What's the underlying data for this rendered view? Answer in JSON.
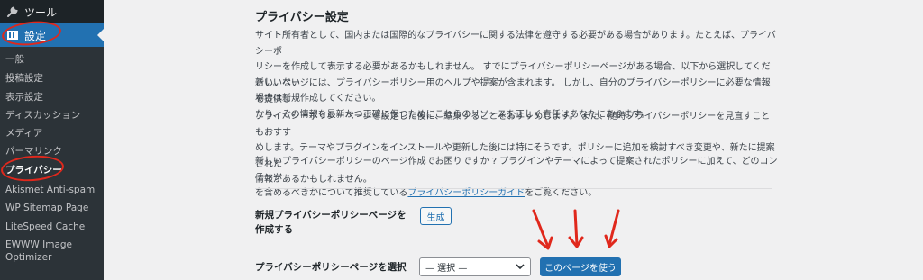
{
  "sidebar": {
    "tools_label": "ツール",
    "settings_label": "設定",
    "items": [
      {
        "label": "一般"
      },
      {
        "label": "投稿設定"
      },
      {
        "label": "表示設定"
      },
      {
        "label": "ディスカッション"
      },
      {
        "label": "メディア"
      },
      {
        "label": "パーマリンク"
      },
      {
        "label": "プライバシー"
      },
      {
        "label": "Akismet Anti-spam"
      },
      {
        "label": "WP Sitemap Page"
      },
      {
        "label": "LiteSpeed Cache"
      },
      {
        "label": "EWWW Image"
      },
      {
        "label": "Optimizer"
      }
    ]
  },
  "main": {
    "title": "プライバシー設定",
    "para1_line1": "サイト所有者として、国内または国際的なプライバシーに関する法律を遵守する必要がある場合があります。たとえば、プライバシーポ",
    "para1_line2": "リシーを作成して表示する必要があるかもしれません。 すでにプライバシーポリシーページがある場合、以下から選択してください。ない",
    "para1_line3": "場合は新規作成してください。",
    "para2_line1": "新しいページには、プライバシーポリシー用のヘルプや提案が含まれます。 しかし、自分のプライバシーポリシーに必要な情報を提供し",
    "para2_line2": "たり、その情報を最新かつ正確に保つためにこれらのリソースを正しく責任はあなたにあります。",
    "para3_line1": "プライバシーポリシーページを設定した後に、編集することをおすすめします。 また、随時プライバシーポリシーを見直すこともおすす",
    "para3_line2": "めします。テーマやプラグインをインストールや更新した後には特にそうです。ポリシーに追加を検討すべき変更や、新たに提案された",
    "para3_line3": "情報があるかもしれません。",
    "para4_line1": "新しいプライバシーポリシーのページ作成でお困りですか ? プラグインやテーマによって提案されたポリシーに加えて、どのコンテンツ",
    "para4_line2_pre": "を含めるべきかについて推奨している",
    "para4_link": "プライバシーポリシーガイド",
    "para4_line2_post": "をご覧ください。",
    "create_label_line1": "新規プライバシーポリシーページを",
    "create_label_line2": "作成する",
    "create_button": "生成",
    "select_label": "プライバシーポリシーページを選択",
    "select_value": "— 選択 —",
    "use_button": "このページを使う"
  }
}
